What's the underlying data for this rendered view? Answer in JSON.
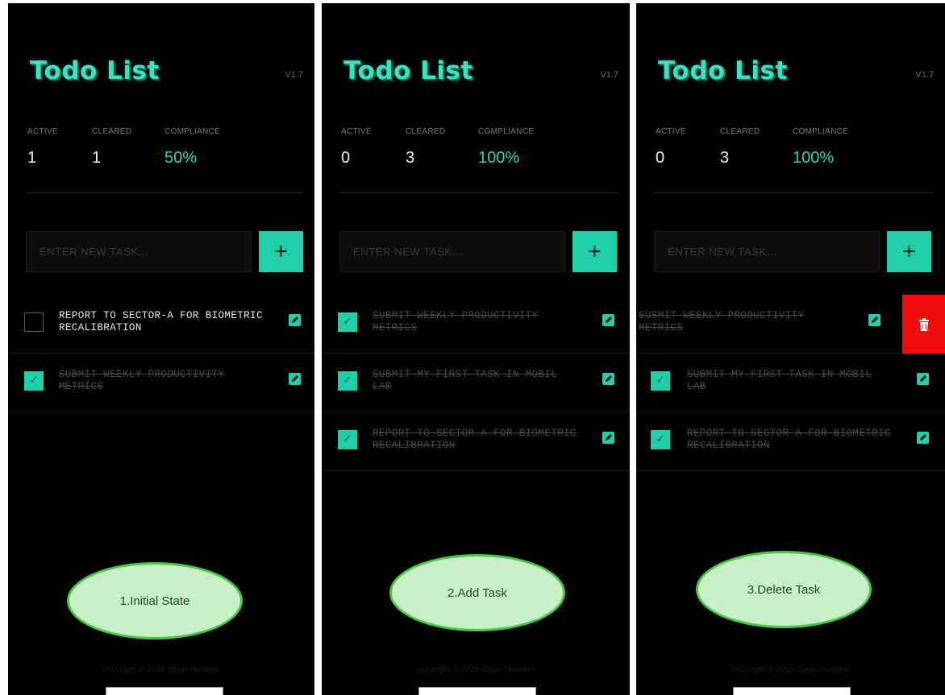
{
  "screens": [
    {
      "title": "Todo List",
      "version": "V1.7",
      "stats": {
        "active_label": "ACTIVE",
        "active": "1",
        "cleared_label": "CLEARED",
        "cleared": "1",
        "compliance_label": "COMPLIANCE",
        "compliance": "50%"
      },
      "input_placeholder": "ENTER NEW TASK...",
      "add_label": "+",
      "tasks": [
        {
          "text": "REPORT TO SECTOR-A FOR BIOMETRIC RECALIBRATION",
          "done": false
        },
        {
          "text": "SUBMIT WEEKLY PRODUCTIVITY METRICS",
          "done": true
        }
      ],
      "caption": "1.Initial State",
      "copyright": "copyright © 2026 Omar Hussein"
    },
    {
      "title": "Todo List",
      "version": "V1.7",
      "stats": {
        "active_label": "ACTIVE",
        "active": "0",
        "cleared_label": "CLEARED",
        "cleared": "3",
        "compliance_label": "COMPLIANCE",
        "compliance": "100%"
      },
      "input_placeholder": "ENTER NEW TASK...",
      "add_label": "+",
      "tasks": [
        {
          "text": "SUBMIT WEEKLY PRODUCTIVITY METRICS",
          "done": true
        },
        {
          "text": "SUBMIT MY FIRST TASK IN MOBIL LAB ",
          "done": true
        },
        {
          "text": "REPORT TO SECTOR-A FOR BIOMETRIC RECALIBRATION",
          "done": true
        }
      ],
      "caption": "2.Add Task",
      "copyright": "copyright © 2026 Omar Hussein"
    },
    {
      "title": "Todo List",
      "version": "V1.7",
      "stats": {
        "active_label": "ACTIVE",
        "active": "0",
        "cleared_label": "CLEARED",
        "cleared": "3",
        "compliance_label": "COMPLIANCE",
        "compliance": "100%"
      },
      "input_placeholder": "ENTER NEW TASK...",
      "add_label": "+",
      "tasks": [
        {
          "text": "SUBMIT WEEKLY PRODUCTIVITY METRICS",
          "done": true
        },
        {
          "text": "SUBMIT MY FIRST TASK IN MOBIL LAB ",
          "done": true
        },
        {
          "text": "REPORT TO SECTOR-A FOR BIOMETRIC RECALIBRATION",
          "done": true
        }
      ],
      "caption": "3.Delete Task",
      "copyright": "copyright © 2026 Omar Hussein"
    }
  ],
  "colors": {
    "accent": "#1fcfa8",
    "delete": "#f20d0d",
    "caption_fill": "#c8f0c6",
    "caption_border": "#49c74a"
  },
  "icons": {
    "edit": "edit-icon",
    "delete": "trash-icon",
    "check": "check-icon"
  }
}
